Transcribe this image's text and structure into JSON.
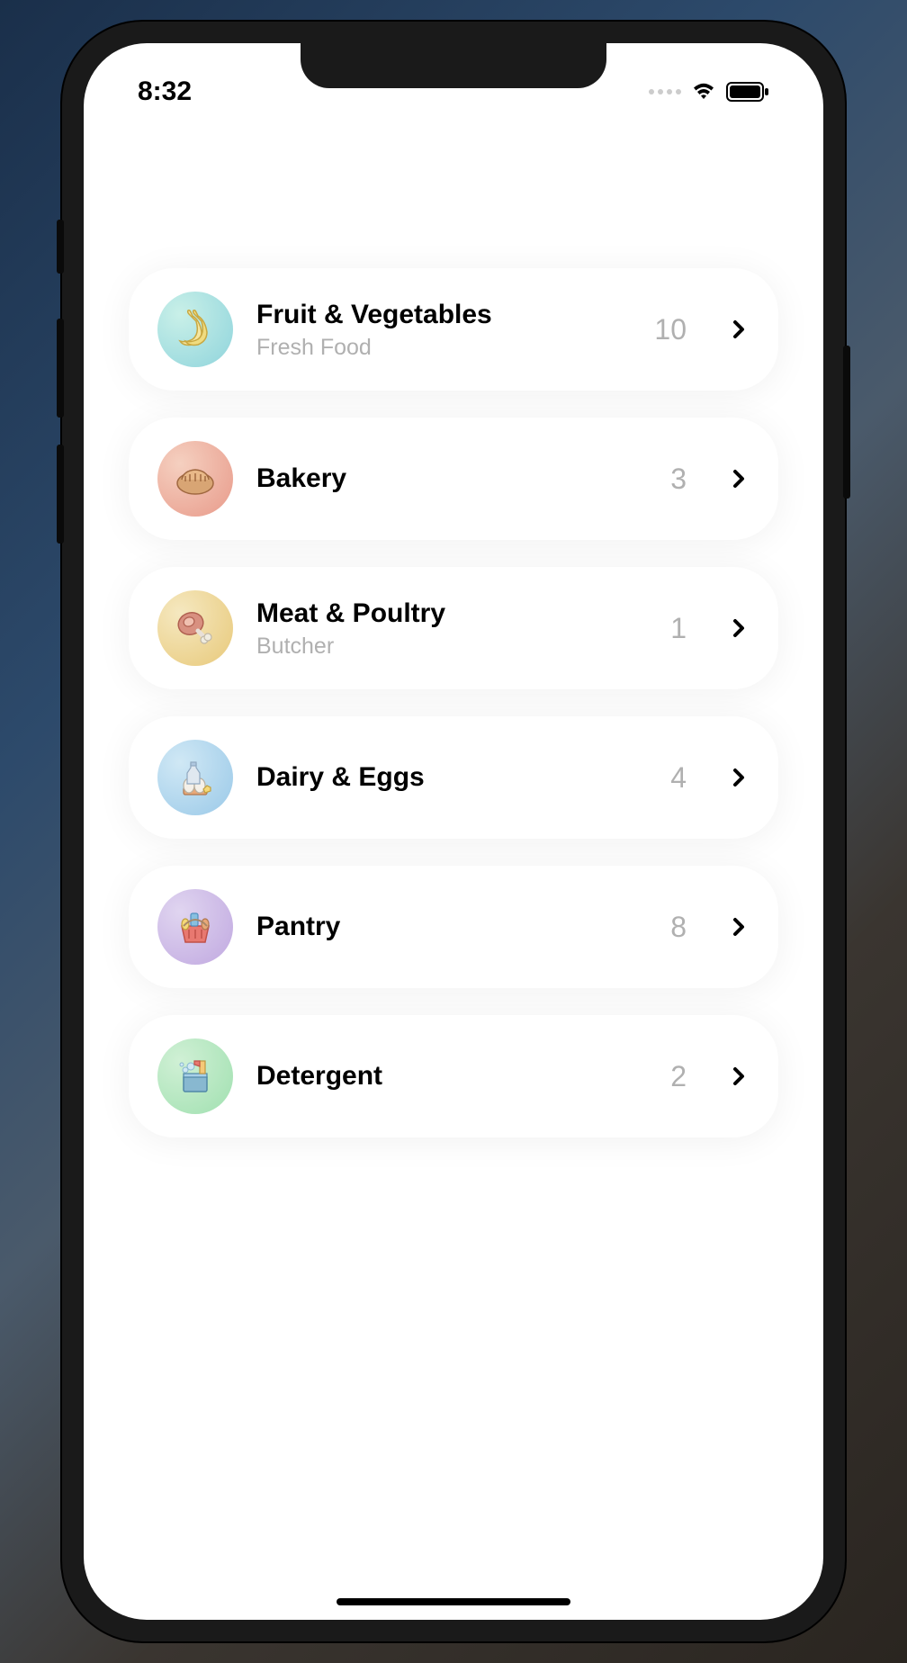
{
  "status": {
    "time": "8:32"
  },
  "categories": [
    {
      "title": "Fruit & Vegetables",
      "subtitle": "Fresh Food",
      "count": "10",
      "icon": "banana-icon",
      "iconClass": "icon-fruit"
    },
    {
      "title": "Bakery",
      "subtitle": "",
      "count": "3",
      "icon": "bread-icon",
      "iconClass": "icon-bakery"
    },
    {
      "title": "Meat & Poultry",
      "subtitle": "Butcher",
      "count": "1",
      "icon": "meat-icon",
      "iconClass": "icon-meat"
    },
    {
      "title": "Dairy & Eggs",
      "subtitle": "",
      "count": "4",
      "icon": "dairy-icon",
      "iconClass": "icon-dairy"
    },
    {
      "title": "Pantry",
      "subtitle": "",
      "count": "8",
      "icon": "basket-icon",
      "iconClass": "icon-pantry"
    },
    {
      "title": "Detergent",
      "subtitle": "",
      "count": "2",
      "icon": "cleaning-icon",
      "iconClass": "icon-detergent"
    }
  ]
}
